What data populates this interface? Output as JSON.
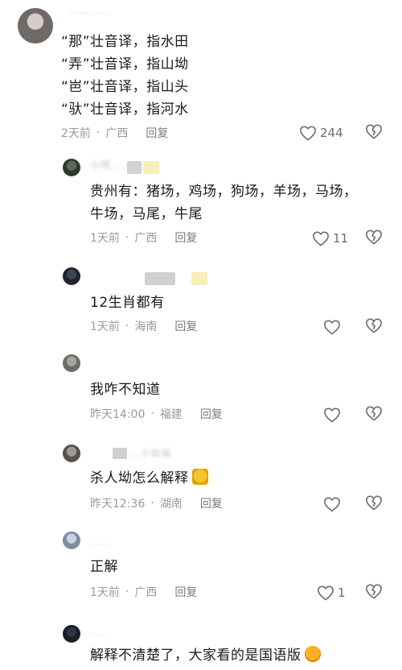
{
  "comments": [
    {
      "username": "…………",
      "lines": [
        "“那”壮音译，指水田",
        "“弄”壮音译，指山坳",
        "“岜”壮音译，指山头",
        "“驮”壮音译，指河水"
      ],
      "time": "2天前",
      "location": "广西",
      "reply": "回复",
      "likes": "244"
    },
    {
      "username": "小明……",
      "lines": [
        "贵州有：猪场，鸡场，狗场，羊场，马场，",
        "牛场，马尾，牛尾"
      ],
      "time": "1天前",
      "location": "广西",
      "reply": "回复",
      "likes": "11"
    },
    {
      "username": "",
      "lines": [
        "12生肖都有"
      ],
      "time": "1天前",
      "location": "海南",
      "reply": "回复",
      "likes": ""
    },
    {
      "username": "",
      "lines": [
        "我咋不知道"
      ],
      "time": "昨天14:00",
      "location": "福建",
      "reply": "回复",
      "likes": ""
    },
    {
      "username": "…小知侯",
      "lines": [
        "杀人坳怎么解释"
      ],
      "time": "昨天12:36",
      "location": "湖南",
      "reply": "回复",
      "likes": ""
    },
    {
      "username": "……",
      "lines": [
        "正解"
      ],
      "time": "1天前",
      "location": "广西",
      "reply": "回复",
      "likes": "1"
    },
    {
      "username": "……",
      "lines": [
        "解释不清楚了，大家看的是国语版"
      ],
      "time": "",
      "location": "",
      "reply": "",
      "likes": ""
    }
  ],
  "meta_separator": "·",
  "icons": {
    "like": "heart-outline-icon",
    "dislike": "broken-heart-icon",
    "emoji_1": "yellow-doge-emoji",
    "emoji_2": "laughing-emoji"
  },
  "colors": {
    "text": "#1a1a1a",
    "meta": "#9a9a9a",
    "icon": "#6c6c6c"
  }
}
